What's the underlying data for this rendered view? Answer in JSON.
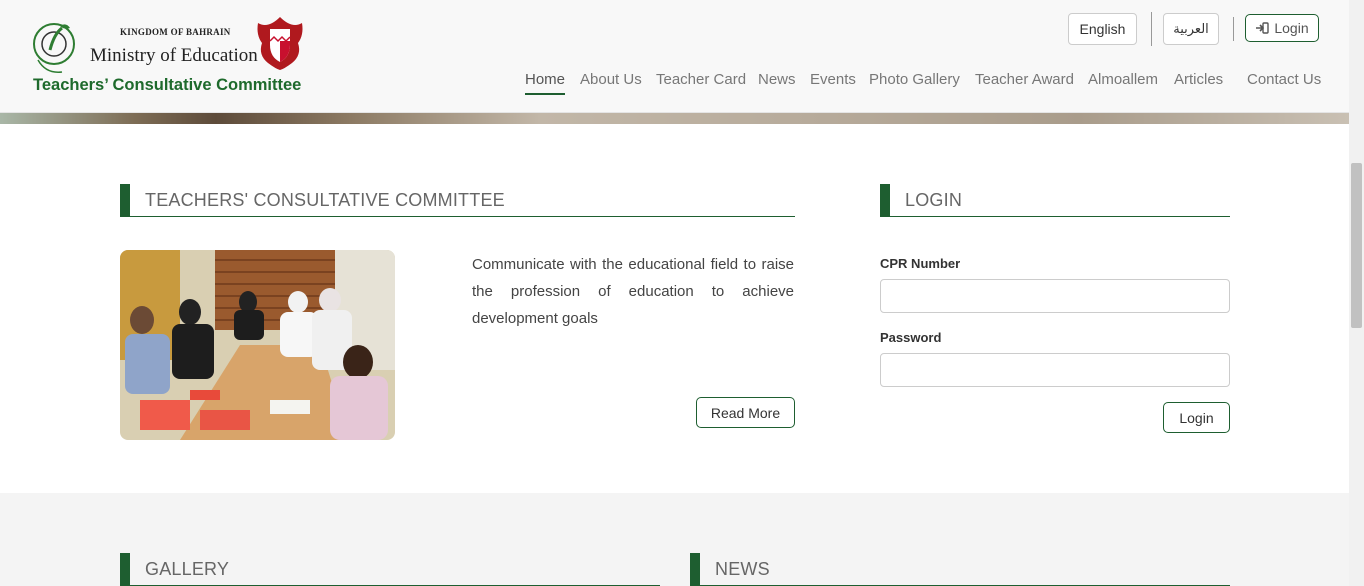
{
  "header": {
    "logo": {
      "kingdom": "KINGDOM OF BAHRAIN",
      "ministry": "Ministry of Education",
      "committee": "Teachers’ Consultative Committee"
    },
    "lang_english": "English",
    "lang_arabic": "العربية",
    "login_label": "Login",
    "nav": {
      "home": "Home",
      "about": "About Us",
      "teacher_card": "Teacher Card",
      "news": "News",
      "events": "Events",
      "photo_gallery": "Photo Gallery",
      "teacher_award": "Teacher Award",
      "almoallem": "Almoallem",
      "articles": "Articles",
      "contact": "Contact Us"
    }
  },
  "committee": {
    "heading": "TEACHERS' CONSULTATIVE COMMITTEE",
    "text": "Communicate with the educational field to raise the profession of education to achieve development goals",
    "read_more": "Read More"
  },
  "login_panel": {
    "heading": "LOGIN",
    "cpr_label": "CPR Number",
    "cpr_value": "",
    "password_label": "Password",
    "password_value": "",
    "submit": "Login"
  },
  "gallery": {
    "heading": "GALLERY"
  },
  "news": {
    "heading": "NEWS"
  },
  "colors": {
    "brand_green": "#1e5e30",
    "logo_green": "#1e6a2c"
  }
}
